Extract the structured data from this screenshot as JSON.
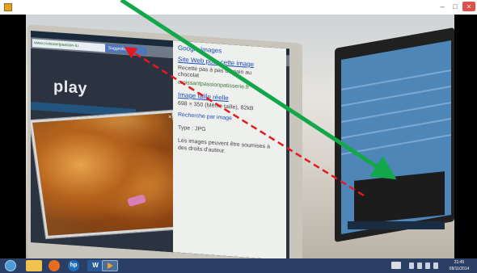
{
  "window": {
    "controls": {
      "minimize": "–",
      "maximize": "□",
      "close": "×"
    }
  },
  "monitor_screen": {
    "browser_url": "www.croissantpassion-lu",
    "browser_tab": "Suggestio",
    "site_logo": "play",
    "photo_close": "×"
  },
  "info_panel": {
    "header": "Google Images",
    "site_link": "Site Web pour cette image",
    "site_desc_1": "Recette pas à pas du pain au",
    "site_desc_2": "chocolat",
    "site_url": "croissantpassionpatisserie.fr",
    "size_link": "Image taille réelle",
    "size_desc": "698 × 350 (Même taille), 82kB",
    "search_link": "Recherche par image",
    "type_line": "Type : JPG",
    "rights_1": "Les images peuvent être soumises à",
    "rights_2": "des droits d'auteur."
  },
  "taskbar": {
    "hp_label": "hp",
    "word_label": "W",
    "clock_time": "21:45",
    "clock_date": "08/11/2014"
  },
  "colors": {
    "green_arrow": "#12a84a",
    "red_arrow": "#e5191f",
    "taskbar": "#2a3f63"
  }
}
